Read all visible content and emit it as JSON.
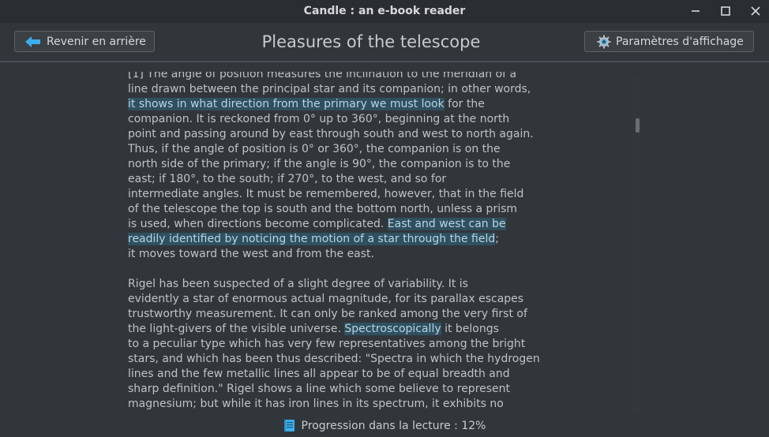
{
  "window": {
    "title": "Candle : an e-book reader"
  },
  "toolbar": {
    "back_label": "Revenir en arrière",
    "page_title": "Pleasures of the telescope",
    "settings_label": "Paramètres d'affichage"
  },
  "content": {
    "paragraph1": [
      [
        {
          "text": "[1] The angle of position measures the inclination to the meridian of a"
        }
      ],
      [
        {
          "text": "line drawn between the principal star and its companion; in other words,"
        }
      ],
      [
        {
          "text": "it shows in what direction from the primary we must look",
          "hl": true
        },
        {
          "text": " for the"
        }
      ],
      [
        {
          "text": "companion. It is reckoned from 0° up to 360°, beginning at the north"
        }
      ],
      [
        {
          "text": "point and passing around by east through south and west to north again."
        }
      ],
      [
        {
          "text": "Thus, if the angle of position is 0° or 360°, the companion is on the"
        }
      ],
      [
        {
          "text": "north side of the primary; if the angle is 90°, the companion is to the"
        }
      ],
      [
        {
          "text": "east; if 180°, to the south; if 270°, to the west, and so for"
        }
      ],
      [
        {
          "text": "intermediate angles. It must be remembered, however, that in the field"
        }
      ],
      [
        {
          "text": "of the telescope the top is south and the bottom north, unless a prism"
        }
      ],
      [
        {
          "text": "is used, when directions become complicated. "
        },
        {
          "text": "East and west can be",
          "hl": true
        }
      ],
      [
        {
          "text": "readily identified by noticing the motion of a star through the field",
          "hl": true
        },
        {
          "text": ";"
        }
      ],
      [
        {
          "text": "it moves toward the west and from the east."
        }
      ]
    ],
    "paragraph2": [
      [
        {
          "text": "Rigel has been suspected of a slight degree of variability. It is"
        }
      ],
      [
        {
          "text": "evidently a star of enormous actual magnitude, for its parallax escapes"
        }
      ],
      [
        {
          "text": "trustworthy measurement. It can only be ranked among the very first of"
        }
      ],
      [
        {
          "text": "the light-givers of the visible universe. "
        },
        {
          "text": "Spectroscopically",
          "hl": true
        },
        {
          "text": " it belongs"
        }
      ],
      [
        {
          "text": "to a peculiar type which has very few representatives among the bright"
        }
      ],
      [
        {
          "text": "stars, and which has been thus described: \"Spectra in which the hydrogen"
        }
      ],
      [
        {
          "text": "lines and the few metallic lines all appear to be of equal breadth and"
        }
      ],
      [
        {
          "text": "sharp definition.\" Rigel shows a line which some believe to represent"
        }
      ],
      [
        {
          "text": "magnesium; but while it has iron lines in its spectrum, it exhibits no"
        }
      ]
    ]
  },
  "status": {
    "progress_label": "Progression dans la lecture : 12%",
    "progress_percent": 12
  },
  "colors": {
    "background": "#31363b",
    "highlight": "#30505f",
    "accent": "#3daee9"
  },
  "icons": {
    "back": "arrow-left-icon",
    "settings": "gear-icon",
    "progress": "book-icon",
    "minimize": "minimize-icon",
    "maximize": "maximize-icon",
    "close": "close-icon"
  }
}
